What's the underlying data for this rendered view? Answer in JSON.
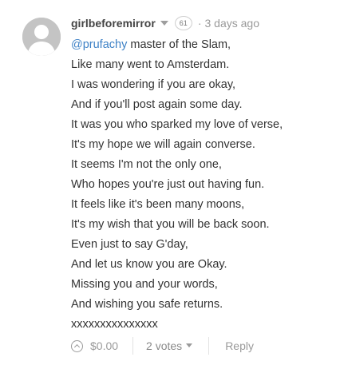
{
  "comment": {
    "author": "girlbeforemirror",
    "reputation": "61",
    "separator": "·",
    "timestamp": "3 days ago",
    "mention": "@prufachy",
    "lines": [
      " master of the Slam,",
      "Like many went to Amsterdam.",
      "I was wondering if you are okay,",
      "And if you'll post again some day.",
      "It was you who sparked my love of verse,",
      "It's my hope we will again converse.",
      "It seems I'm not the only one,",
      "Who hopes you're just out having fun.",
      "It feels like it's been many moons,",
      "It's my wish that you will be back soon.",
      "Even just to say G'day,",
      "And let us know you are Okay.",
      "Missing you and your words,",
      "And wishing you safe returns.",
      "xxxxxxxxxxxxxxx"
    ]
  },
  "footer": {
    "payout": "$0.00",
    "votes_label": "2 votes",
    "reply_label": "Reply"
  },
  "icons": {
    "avatar": "default-user-avatar",
    "upvote": "upvote-circle-icon",
    "author_menu": "chevron-down-icon",
    "votes_menu": "chevron-down-icon"
  },
  "colors": {
    "mention": "#3d81c6",
    "text": "#333333",
    "muted": "#999999"
  }
}
